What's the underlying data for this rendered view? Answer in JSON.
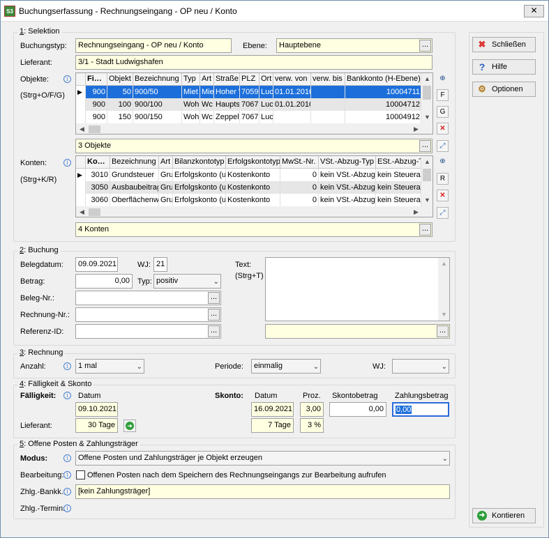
{
  "window": {
    "title": "Buchungserfassung - Rechnungseingang - OP neu / Konto",
    "app_icon": "S3"
  },
  "sel": {
    "legend_num": "1",
    "legend": ": Selektion",
    "buchungstyp_label": "Buchungstyp:",
    "buchungstyp": "Rechnungseingang - OP neu / Konto",
    "ebene_label": "Ebene:",
    "ebene": "Hauptebene",
    "lieferant_label": "Lieferant:",
    "lieferant": "3/1 - Stadt Ludwigshafen",
    "objekte_label": "Objekte:",
    "objekte_hint": "(Strg+O/F/G)",
    "obj_columns": [
      "Fi…",
      "Objekt",
      "Bezeichnung",
      "Typ",
      "Art",
      "Straße",
      "PLZ",
      "Ort",
      "verw. von",
      "verw. bis",
      "Bankkonto (H-Ebene)"
    ],
    "obj_rows": [
      [
        "900",
        "50",
        "900/50",
        "Miet",
        "Mie",
        "Hoher W",
        "7059",
        "Luc",
        "01.01.2016",
        "",
        "10004711"
      ],
      [
        "900",
        "100",
        "900/100",
        "Woh",
        "Wc",
        "Haupts",
        "7067",
        "Luc",
        "01.01.2016",
        "",
        "10004712"
      ],
      [
        "900",
        "150",
        "900/150",
        "Woh",
        "Wc",
        "Zeppel",
        "7067",
        "Luc",
        "",
        "",
        "10004912"
      ]
    ],
    "objekte_summary": "3 Objekte",
    "konten_label": "Konten:",
    "konten_hint": "(Strg+K/R)",
    "kto_columns": [
      "Ko…",
      "Bezeichnung",
      "Art",
      "Bilanzkontotyp",
      "Erfolgskontotyp",
      "MwSt.-Nr.",
      "VSt.-Abzug-Typ",
      "ESt.-Abzug-T"
    ],
    "kto_rows": [
      [
        "3010",
        "Grundsteuer",
        "Gru",
        "Erfolgskonto (u",
        "Kostenkonto",
        "0",
        "kein VSt.-Abzug",
        "kein Steueral"
      ],
      [
        "3050",
        "Ausbaubeitrag",
        "Gru",
        "Erfolgskonto (u",
        "Kostenkonto",
        "0",
        "kein VSt.-Abzug",
        "kein Steueral"
      ],
      [
        "3060",
        "Oberflächenw",
        "Gru",
        "Erfolgskonto (u",
        "Kostenkonto",
        "0",
        "kein VSt.-Abzug",
        "kein Steueral"
      ]
    ],
    "konten_summary": "4 Konten",
    "tb_f": "F",
    "tb_g": "G",
    "tb_r": "R",
    "dots": "..."
  },
  "buch": {
    "legend_num": "2",
    "legend": ": Buchung",
    "belegdatum_label": "Belegdatum:",
    "belegdatum": "09.09.2021",
    "wj_label": "WJ:",
    "wj": "21",
    "betrag_label": "Betrag:",
    "betrag": "0,00",
    "typ_label": "Typ:",
    "typ": "positiv",
    "belegnr_label": "Beleg-Nr.:",
    "rechnungsnr_label": "Rechnung-Nr.:",
    "referenz_label": "Referenz-ID:",
    "text_label": "Text:",
    "text_hint": "(Strg+T)"
  },
  "rech": {
    "legend_num": "3",
    "legend": ": Rechnung",
    "anzahl_label": "Anzahl:",
    "anzahl": "1 mal",
    "periode_label": "Periode:",
    "periode": "einmalig",
    "wj_label": "WJ:",
    "wj": ""
  },
  "fael": {
    "legend_num": "4",
    "legend": ": Fälligkeit & Skonto",
    "faelligkeit_label": "Fälligkeit:",
    "datum_label": "Datum",
    "datum": "09.10.2021",
    "lieferant_label": "Lieferant:",
    "lieferant_tage": "30 Tage",
    "skonto_label": "Skonto:",
    "sk_datum_label": "Datum",
    "sk_datum": "16.09.2021",
    "proz_label": "Proz.",
    "proz": "3,00",
    "sk_tage": "7 Tage",
    "sk_proz": "3 %",
    "skontobetrag_label": "Skontobetrag",
    "skontobetrag": "0,00",
    "zahlungsbetrag_label": "Zahlungsbetrag",
    "zahlungsbetrag": "0,00"
  },
  "op": {
    "legend_num": "5",
    "legend": ": Offene Posten & Zahlungsträger",
    "modus_label": "Modus:",
    "modus": "Offene Posten und Zahlungsträger je Objekt erzeugen",
    "bearbeitung_label": "Bearbeitung:",
    "bearbeitung_text": "Offenen Posten nach dem Speichern des Rechnungseingangs zur Bearbeitung aufrufen",
    "zhlg_bankk_label": "Zhlg.-Bankk.:",
    "zhlg_bankk": "[kein Zahlungsträger]",
    "zhlg_termin_label": "Zhlg.-Termin:"
  },
  "buttons": {
    "schliessen": "Schließen",
    "hilfe": "Hilfe",
    "optionen": "Optionen",
    "kontieren": "Kontieren"
  },
  "info_glyph": "i",
  "dropdown_glyph": "⌄"
}
